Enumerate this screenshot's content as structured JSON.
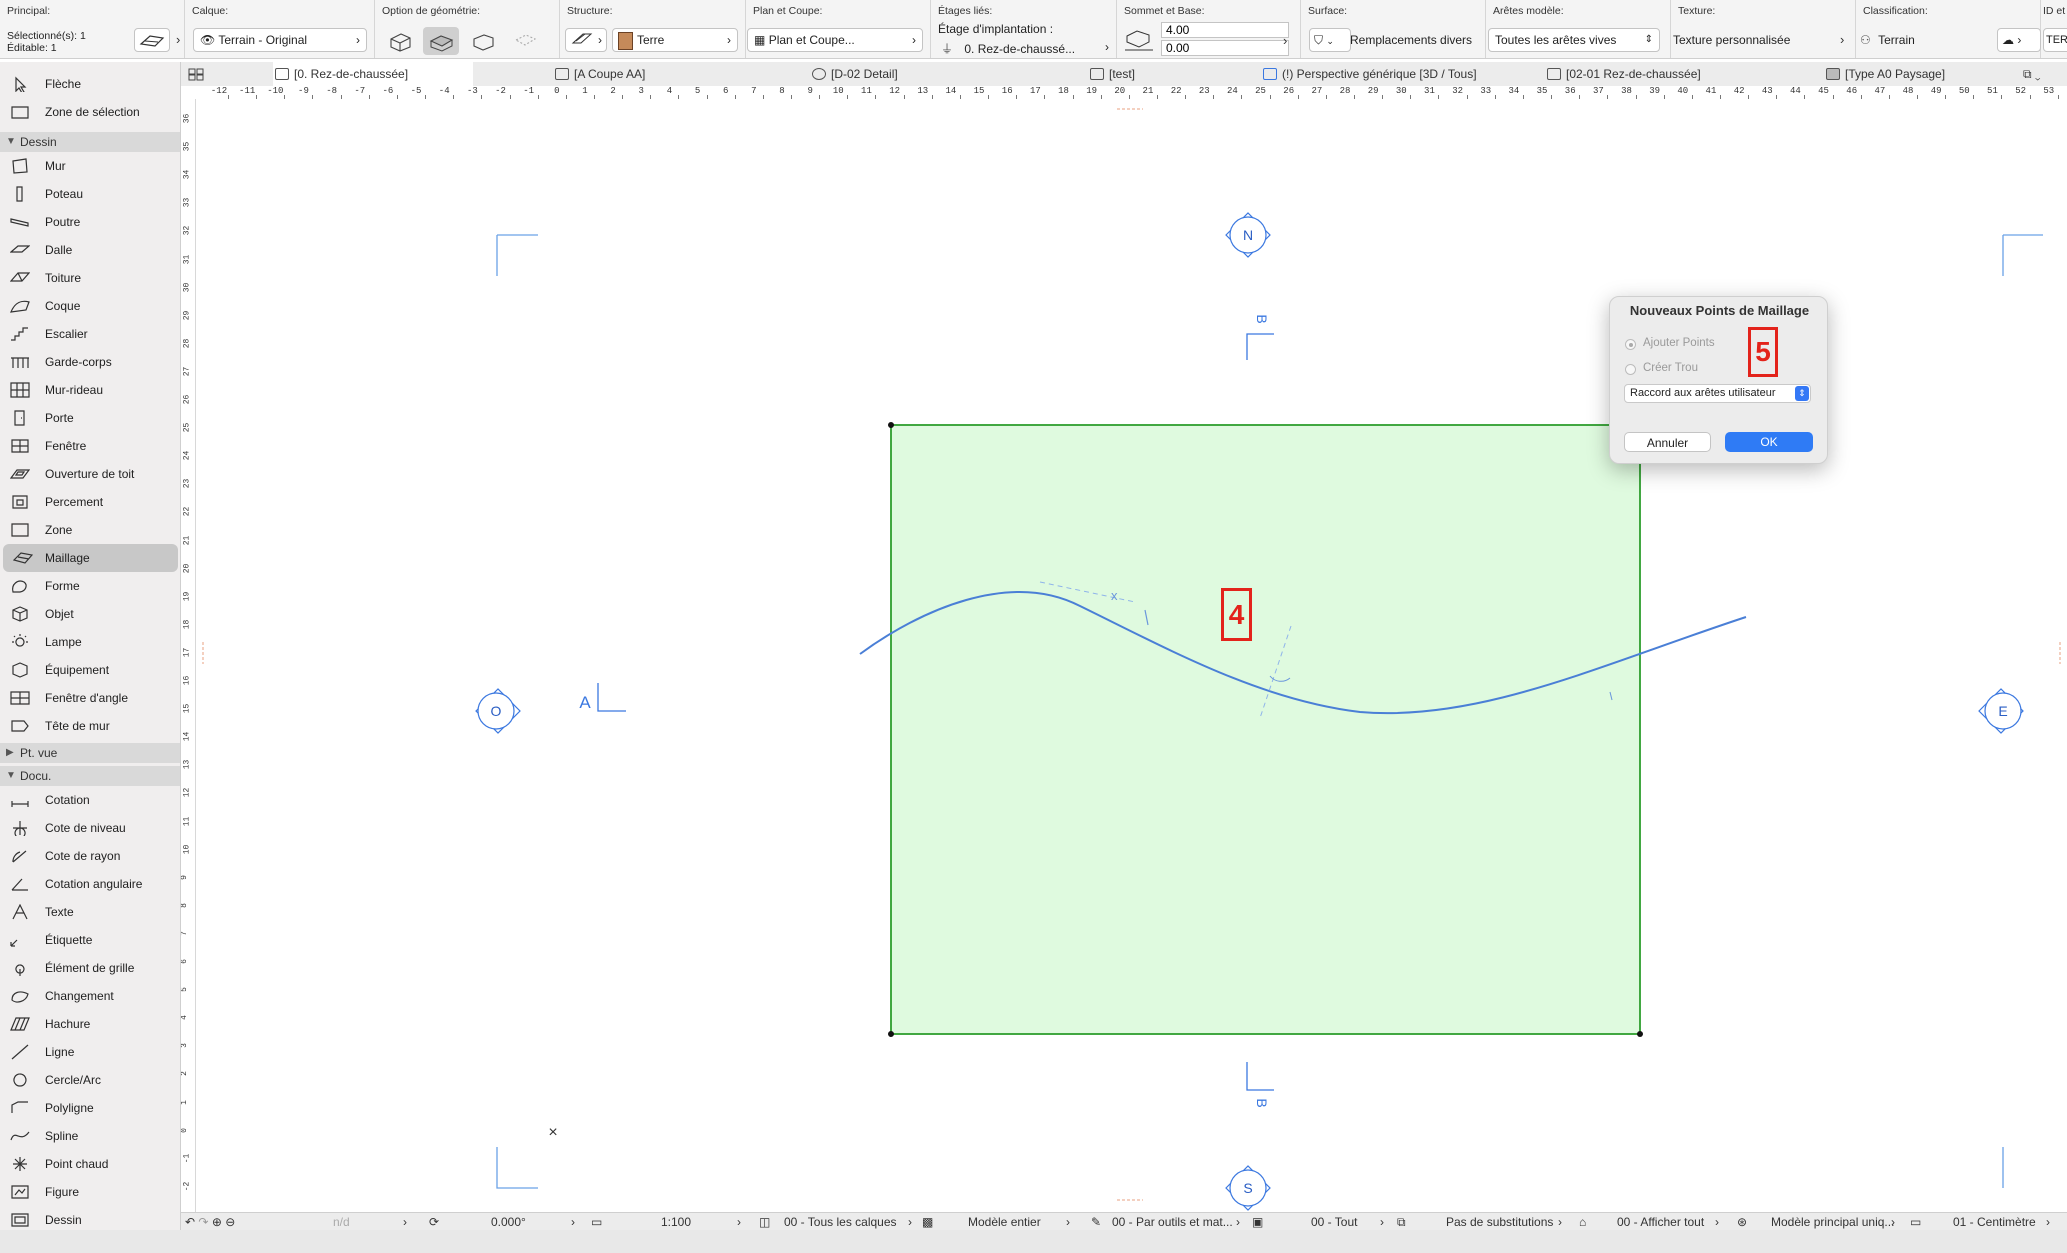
{
  "infobar": {
    "principal": {
      "label": "Principal:",
      "selected": "Sélectionné(s): 1",
      "editable": "Éditable: 1"
    },
    "calque": {
      "label": "Calque:",
      "value": "Terrain - Original"
    },
    "option_geometrie": {
      "label": "Option de géométrie:"
    },
    "structure": {
      "label": "Structure:",
      "value": "Terre"
    },
    "plan_coupe": {
      "label": "Plan et Coupe:",
      "value": "Plan et Coupe..."
    },
    "etages_lies": {
      "label": "Étages liés:",
      "sub": "Étage d'implantation :",
      "value": "0. Rez-de-chaussé..."
    },
    "sommet_base": {
      "label": "Sommet et Base:",
      "top": "4.00",
      "bottom": "0.00"
    },
    "surface": {
      "label": "Surface:",
      "value": "Remplacements divers"
    },
    "aretes_modele": {
      "label": "Arêtes modèle:",
      "value": "Toutes les arêtes vives"
    },
    "texture": {
      "label": "Texture:",
      "value": "Texture personnalisée"
    },
    "classification": {
      "label": "Classification:",
      "value": "Terrain"
    },
    "id": {
      "label": "ID et",
      "value": "TER"
    }
  },
  "tabs": [
    {
      "label": "[0. Rez-de-chaussée]",
      "active": true
    },
    {
      "label": "[A Coupe AA]",
      "active": false
    },
    {
      "label": "[D-02 Detail]",
      "active": false
    },
    {
      "label": "[test]",
      "active": false
    },
    {
      "label": "(!) Perspective générique [3D / Tous]",
      "active": false
    },
    {
      "label": "[02-01 Rez-de-chaussée]",
      "active": false
    },
    {
      "label": "[Type A0 Paysage]",
      "active": false
    }
  ],
  "toolbox": {
    "top_tools": [
      "Flèche",
      "Zone de sélection"
    ],
    "groups": [
      {
        "name": "Dessin",
        "tools": [
          "Mur",
          "Poteau",
          "Poutre",
          "Dalle",
          "Toiture",
          "Coque",
          "Escalier",
          "Garde-corps",
          "Mur-rideau",
          "Porte",
          "Fenêtre",
          "Ouverture de toit",
          "Percement",
          "Zone",
          "Maillage",
          "Forme",
          "Objet",
          "Lampe",
          "Équipement",
          "Fenêtre d'angle",
          "Tête de mur"
        ]
      },
      {
        "name": "Pt. vue",
        "tools": []
      },
      {
        "name": "Docu.",
        "tools": [
          "Cotation",
          "Cote de niveau",
          "Cote de rayon",
          "Cotation angulaire",
          "Texte",
          "Étiquette",
          "Élément de grille",
          "Changement",
          "Hachure",
          "Ligne",
          "Cercle/Arc",
          "Polyligne",
          "Spline",
          "Point chaud",
          "Figure",
          "Dessin"
        ]
      }
    ],
    "selected_tool": "Maillage"
  },
  "canvas": {
    "markers": {
      "north": "N",
      "south": "S",
      "east": "E",
      "west": "O",
      "section_a": "A",
      "section_b": "B"
    },
    "badge_spline": "4",
    "badge_dialog": "5",
    "close_mark": "×",
    "mesh_fill_color": "#dffadf",
    "mesh_stroke_color": "#2e9e2e",
    "curve_color": "#4a7fd6",
    "marker_color": "#3b78e0"
  },
  "dialog": {
    "title": "Nouveaux Points de Maillage",
    "option1": "Ajouter Points",
    "option2": "Créer Trou",
    "select": "Raccord aux arêtes utilisateur",
    "cancel": "Annuler",
    "ok": "OK"
  },
  "statusbar": {
    "nd": "n/d",
    "angle": "0.000°",
    "scale": "1:100",
    "layers": "00 - Tous les calques",
    "model": "Modèle entier",
    "pens": "00 - Par outils et mat...",
    "filter": "00 - Tout",
    "substitutions": "Pas de substitutions",
    "display": "00 - Afficher tout",
    "main_model": "Modèle principal uniq...",
    "unit": "01 - Centimètre"
  },
  "ruler": {
    "h_labels": [
      "-12",
      "-11",
      "-10",
      "-9",
      "-8",
      "-7",
      "-6",
      "-5",
      "-4",
      "-3",
      "-2",
      "-1",
      "0",
      "1",
      "2",
      "3",
      "4",
      "5",
      "6",
      "7",
      "8",
      "9",
      "10",
      "11",
      "12",
      "13",
      "14",
      "15",
      "16",
      "17",
      "18",
      "19",
      "20",
      "21",
      "22",
      "23",
      "24",
      "25",
      "26",
      "27",
      "28",
      "29",
      "30",
      "31",
      "32",
      "33",
      "34",
      "35",
      "36",
      "37",
      "38",
      "39",
      "40",
      "41",
      "42",
      "43",
      "44",
      "45",
      "46",
      "47",
      "48",
      "49",
      "50",
      "51",
      "52",
      "53"
    ],
    "v_labels": [
      "36",
      "35",
      "34",
      "33",
      "32",
      "31",
      "30",
      "29",
      "28",
      "27",
      "26",
      "25",
      "24",
      "23",
      "22",
      "21",
      "20",
      "19",
      "18",
      "17",
      "16",
      "15",
      "14",
      "13",
      "12",
      "11",
      "10",
      "9",
      "8",
      "7",
      "6",
      "5",
      "4",
      "3",
      "2",
      "1",
      "0",
      "-1",
      "-2"
    ]
  }
}
